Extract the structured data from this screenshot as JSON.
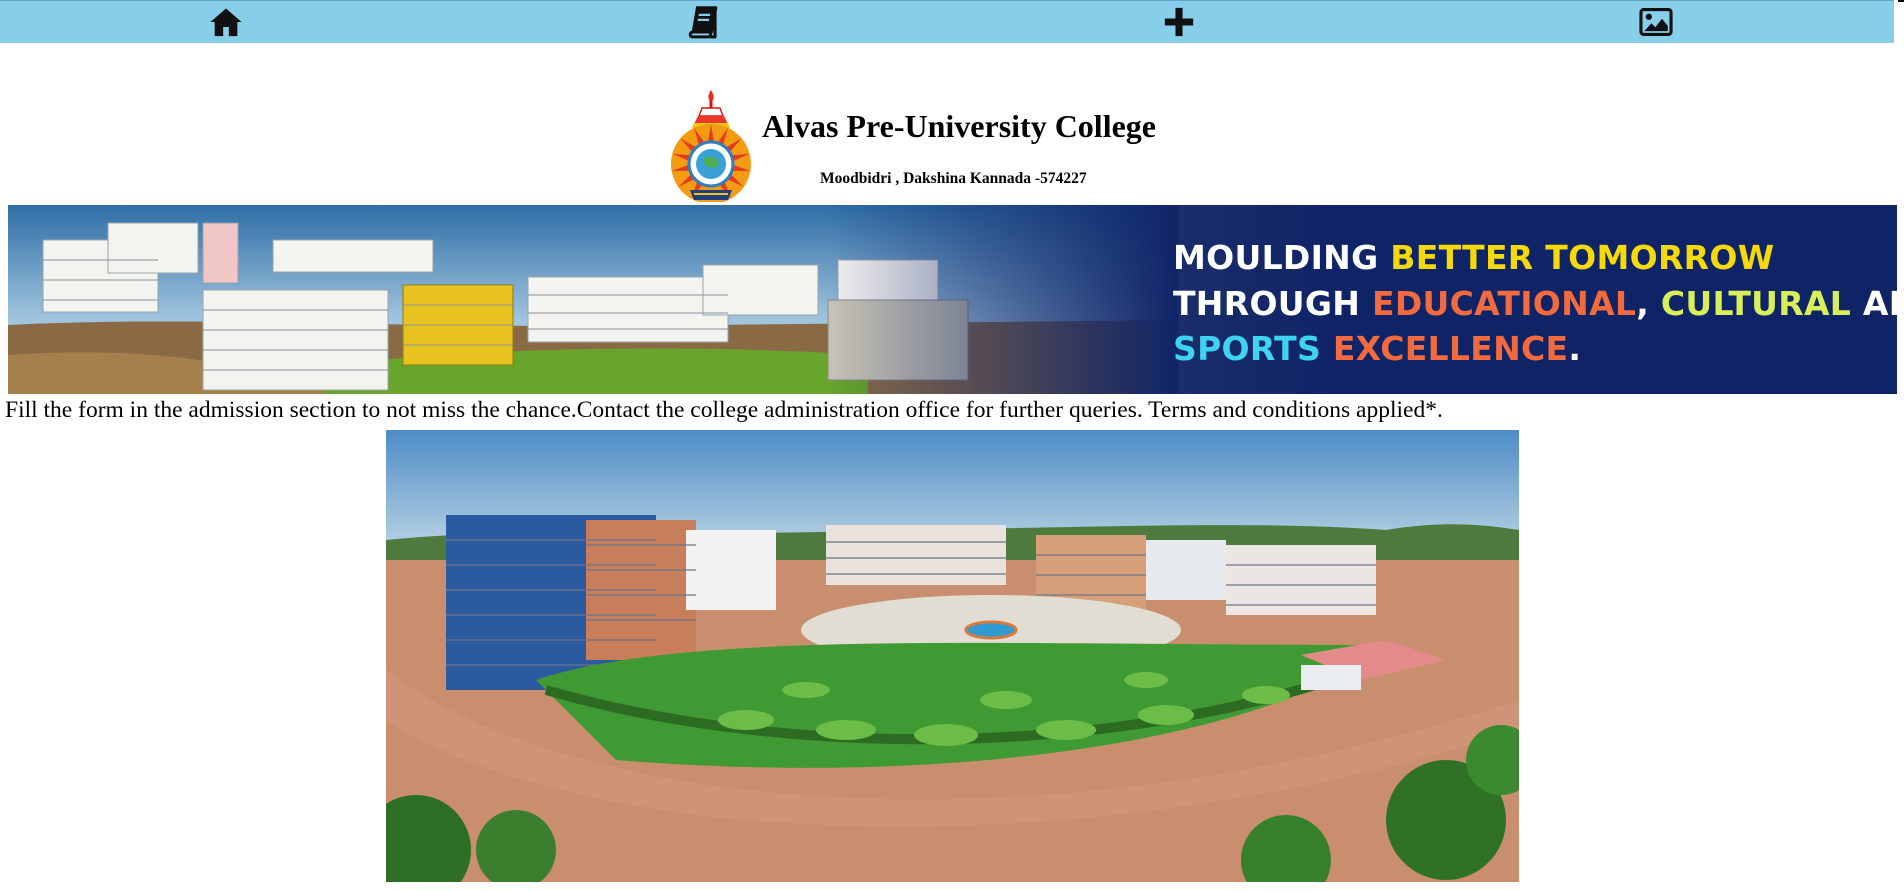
{
  "navbar": {
    "background": "#87ceeb",
    "items": [
      {
        "icon": "home-icon"
      },
      {
        "icon": "book-icon"
      },
      {
        "icon": "plus-icon"
      },
      {
        "icon": "image-icon"
      }
    ]
  },
  "header": {
    "title": "Alvas Pre-University College",
    "address": "Moodbidri , Dakshina Kannada -574227",
    "logo_icon": "college-emblem"
  },
  "banner": {
    "background": "#0f2467",
    "line1": {
      "white": "MOULDING ",
      "yellow": "BETTER TOMORROW"
    },
    "line2": {
      "white1": "THROUGH ",
      "orange": "EDUCATIONAL",
      "comma": ", ",
      "lime": "CULTURAL",
      "white2": " AND"
    },
    "line3": {
      "cyan": "SPORTS ",
      "orange": "EXCELLENCE",
      "dot": "."
    },
    "colors": {
      "yellow": "#f5d90a",
      "orange": "#f26a3d",
      "lime": "#d8ef5a",
      "cyan": "#3fd3f2"
    }
  },
  "notice": {
    "text": "Fill the form in the admission section to not miss the chance.Contact the college administration office for further queries. Terms and conditions applied*."
  }
}
